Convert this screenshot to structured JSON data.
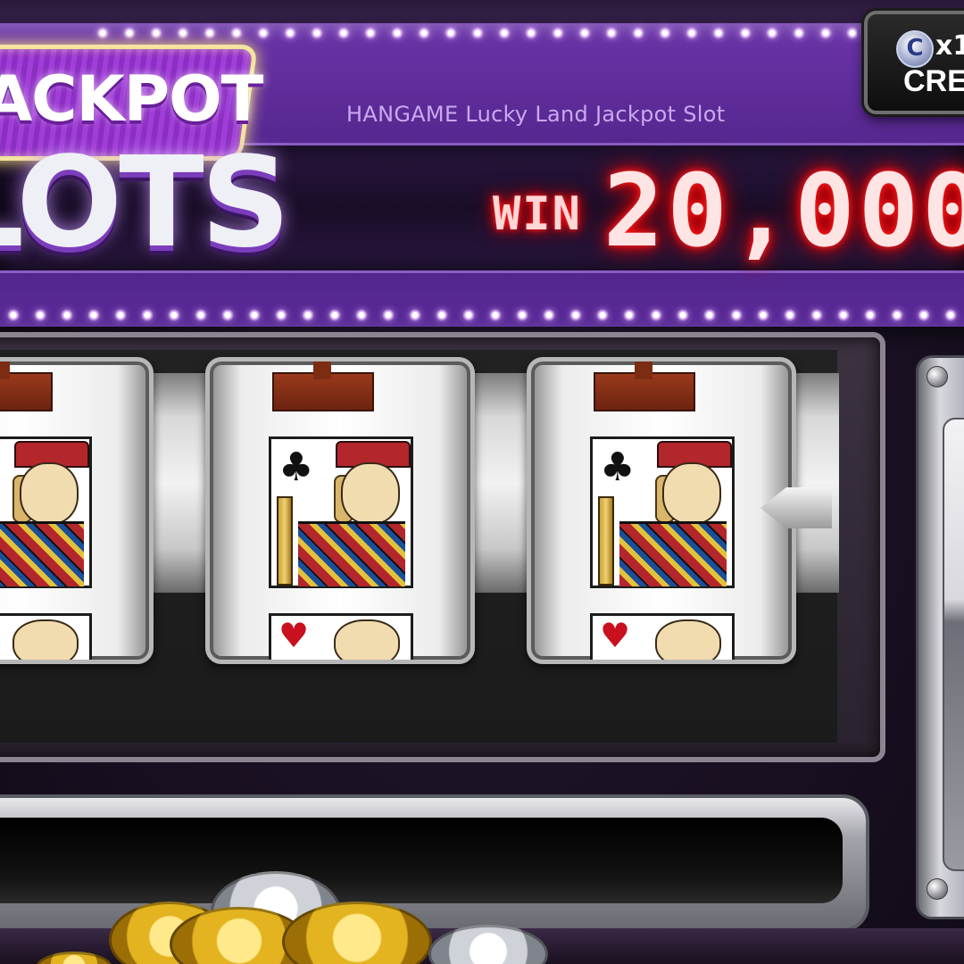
{
  "header": {
    "logo_top": "ACKPOT",
    "logo_bottom": "LOTS",
    "subtitle": "HANGAME Lucky Land Jackpot Slot",
    "win_label": "WIN",
    "win_amount": "20,000,0"
  },
  "credit": {
    "coin_symbol": "C",
    "multiplier": "x1",
    "label": "CRED"
  },
  "reels": [
    {
      "top_symbol": "bar",
      "card_suit": "♣",
      "card": "king-of-clubs",
      "lower_suit": "♥"
    },
    {
      "top_symbol": "bar",
      "card_suit": "♣",
      "card": "king-of-clubs",
      "lower_suit": "♥"
    },
    {
      "top_symbol": "bar",
      "card_suit": "♣",
      "card": "king-of-clubs",
      "lower_suit": "♥"
    }
  ],
  "colors": {
    "header_purple": "#5b2a96",
    "win_red": "#ff2020",
    "subtitle": "#c9a8f0"
  }
}
